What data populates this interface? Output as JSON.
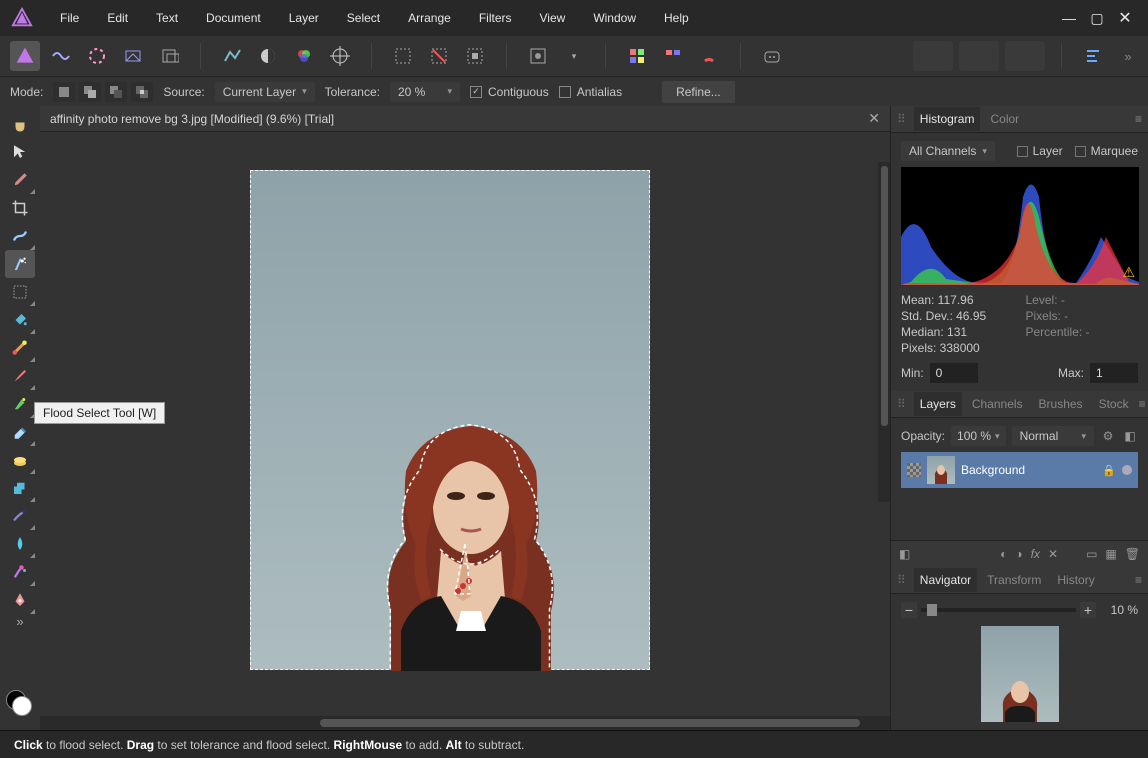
{
  "menu": [
    "File",
    "Edit",
    "Text",
    "Document",
    "Layer",
    "Select",
    "Arrange",
    "Filters",
    "View",
    "Window",
    "Help"
  ],
  "context": {
    "mode_label": "Mode:",
    "source_label": "Source:",
    "source_value": "Current Layer",
    "tolerance_label": "Tolerance:",
    "tolerance_value": "20 %",
    "contiguous_label": "Contiguous",
    "antialias_label": "Antialias",
    "refine_label": "Refine..."
  },
  "document": {
    "title": "affinity photo remove bg 3.jpg [Modified] (9.6%) [Trial]"
  },
  "tooltip": "Flood Select Tool [W]",
  "panels": {
    "hist_tabs": [
      "Histogram",
      "Color"
    ],
    "channel_value": "All Channels",
    "layer_chk": "Layer",
    "marquee_chk": "Marquee",
    "stats": {
      "mean": "Mean: 117.96",
      "stddev": "Std. Dev.: 46.95",
      "median": "Median: 131",
      "pixels": "Pixels: 338000",
      "level": "Level: -",
      "pixels2": "Pixels: -",
      "percentile": "Percentile: -"
    },
    "min_label": "Min:",
    "min_value": "0",
    "max_label": "Max:",
    "max_value": "1",
    "layer_tabs": [
      "Layers",
      "Channels",
      "Brushes",
      "Stock"
    ],
    "opacity_label": "Opacity:",
    "opacity_value": "100 %",
    "blend_value": "Normal",
    "layer_name": "Background",
    "nav_tabs": [
      "Navigator",
      "Transform",
      "History"
    ],
    "zoom_value": "10 %"
  },
  "status": {
    "click": "Click",
    "click_txt": " to flood select. ",
    "drag": "Drag",
    "drag_txt": " to set tolerance and flood select. ",
    "rmb": "RightMouse",
    "rmb_txt": " to add. ",
    "alt": "Alt",
    "alt_txt": " to subtract."
  }
}
